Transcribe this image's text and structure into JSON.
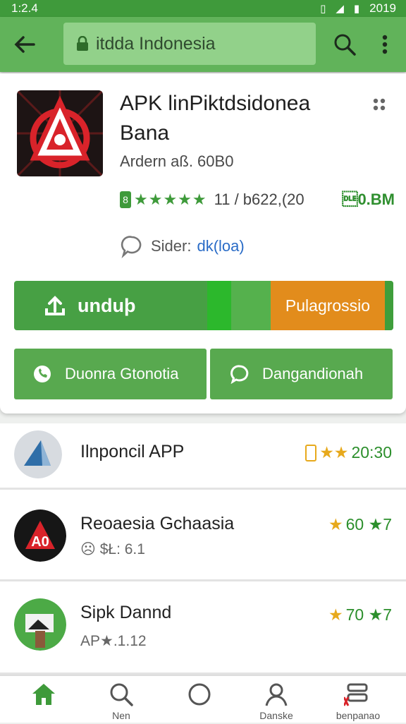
{
  "status": {
    "time": "1:2.4",
    "right": "2019"
  },
  "appbar": {
    "url": "itdda Indonesia"
  },
  "app": {
    "title": "APK linPiktdsidonea Bana",
    "developer": "Ardern aß. 60B0",
    "rating_badge": "8",
    "stars": "★★★★★",
    "rating_text": "11 / b622,(20",
    "size": "\u00100.BM",
    "sider_label": "Sider:",
    "sider_link": "dk(loa)"
  },
  "download": {
    "label": "unduþ",
    "progress_label": "Pulagrossio"
  },
  "actions": {
    "left": "Duonra Gtonotia",
    "right": "Dangandionah"
  },
  "list": [
    {
      "title": "Ilnponcil APP",
      "sub": "",
      "rating": "20:30",
      "icon": "triangle-app-icon"
    },
    {
      "title": "Reoaesia Gchaasia",
      "sub": "☹ $Ł: 6.1",
      "rating": "60 ★7",
      "icon": "red-a-app-icon"
    },
    {
      "title": "Sipk Dannd",
      "sub": "AP★.1.12",
      "rating": "70 ★7",
      "icon": "green-photo-app-icon"
    }
  ],
  "nav": [
    {
      "label": "",
      "icon": "home-icon"
    },
    {
      "label": "Nen",
      "icon": "search-icon"
    },
    {
      "label": "",
      "icon": "circle-icon"
    },
    {
      "label": "Danske",
      "icon": "profile-icon"
    },
    {
      "label": "benpanao",
      "icon": "library-icon"
    }
  ],
  "colors": {
    "green": "#61b35a",
    "dark_green": "#3e9a3a",
    "orange": "#e28c1c",
    "link": "#2a6cc7"
  }
}
